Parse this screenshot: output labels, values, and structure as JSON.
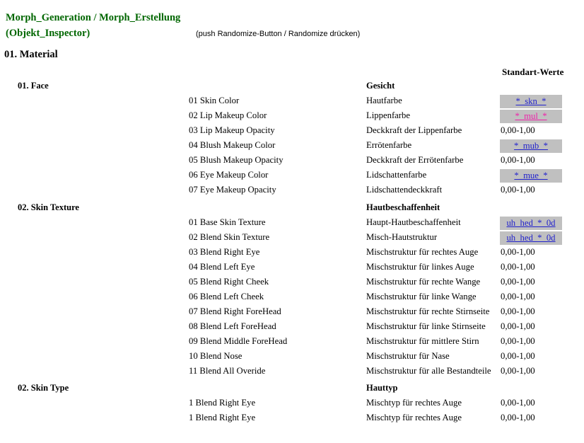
{
  "header": {
    "title_line1": "Morph_Generation / Morph_Erstellung",
    "title_line2": "(Objekt_Inspector)",
    "note": "(push Randomize-Button / Randomize drücken)",
    "material_heading": "01. Material",
    "column_header_values": "Standart-Werte"
  },
  "range_default": "0,00-1,00",
  "sections": [
    {
      "id": "face",
      "title_en": "01. Face",
      "title_de": "Gesicht",
      "rows": [
        {
          "en": "01 Skin Color",
          "de": "Hautfarbe",
          "value": "*_skn_*",
          "kind": "badge",
          "color": "blue"
        },
        {
          "en": "02 Lip Makeup Color",
          "de": "Lippenfarbe",
          "value": "*_mul_*",
          "kind": "badge",
          "color": "pink"
        },
        {
          "en": "03 Lip Makeup Opacity",
          "de": "Deckkraft der Lippenfarbe",
          "value": "0,00-1,00",
          "kind": "text"
        },
        {
          "en": "04 Blush Makeup Color",
          "de": "Errötenfarbe",
          "value": "*_mub_*",
          "kind": "badge",
          "color": "blue"
        },
        {
          "en": "05 Blush Makeup Opacity",
          "de": "Deckkraft der Errötenfarbe",
          "value": "0,00-1,00",
          "kind": "text"
        },
        {
          "en": "06 Eye Makeup Color",
          "de": "Lidschattenfarbe",
          "value": "*_mue_*",
          "kind": "badge",
          "color": "blue"
        },
        {
          "en": "07 Eye Makeup Opacity",
          "de": "Lidschattendeckkraft",
          "value": "0,00-1,00",
          "kind": "text"
        }
      ]
    },
    {
      "id": "skin-texture",
      "title_en": "02. Skin Texture",
      "title_de": "Hautbeschaffenheit",
      "rows": [
        {
          "en": "01 Base Skin Texture",
          "de": "Haupt-Hautbeschaffenheit",
          "value": "uh_hed_*_0d",
          "kind": "badge",
          "color": "blue"
        },
        {
          "en": "02 Blend Skin Texture",
          "de": "Misch-Hautstruktur",
          "value": "uh_hed_*_0d",
          "kind": "badge",
          "color": "blue"
        },
        {
          "en": "03 Blend Right Eye",
          "de": "Mischstruktur für rechtes Auge",
          "value": "0,00-1,00",
          "kind": "text"
        },
        {
          "en": "04 Blend Left Eye",
          "de": "Mischstruktur für linkes Auge",
          "value": "0,00-1,00",
          "kind": "text"
        },
        {
          "en": "05 Blend Right Cheek",
          "de": "Mischstruktur für rechte Wange",
          "value": "0,00-1,00",
          "kind": "text"
        },
        {
          "en": "06 Blend Left Cheek",
          "de": "Mischstruktur für linke Wange",
          "value": "0,00-1,00",
          "kind": "text"
        },
        {
          "en": "07 Blend Right ForeHead",
          "de": "Mischstruktur für rechte Stirnseite",
          "value": "0,00-1,00",
          "kind": "text"
        },
        {
          "en": "08 Blend Left ForeHead",
          "de": "Mischstruktur für linke Stirnseite",
          "value": "0,00-1,00",
          "kind": "text"
        },
        {
          "en": "09 Blend Middle ForeHead",
          "de": "Mischstruktur für mittlere Stirn",
          "value": "0,00-1,00",
          "kind": "text"
        },
        {
          "en": "10 Blend Nose",
          "de": "Mischstruktur für Nase",
          "value": "0,00-1,00",
          "kind": "text"
        },
        {
          "en": "11 Blend All Overide",
          "de": "Mischstruktur für alle Bestandteile",
          "value": "0,00-1,00",
          "kind": "text"
        }
      ]
    },
    {
      "id": "skin-type",
      "title_en": "02. Skin Type",
      "title_de": "Hauttyp",
      "rows": [
        {
          "en": "1 Blend Right Eye",
          "de": "Mischtyp für rechtes Auge",
          "value": "0,00-1,00",
          "kind": "text"
        },
        {
          "en": "1 Blend Right Eye",
          "de": "Mischtyp für rechtes Auge",
          "value": "0,00-1,00",
          "kind": "text"
        }
      ]
    }
  ]
}
